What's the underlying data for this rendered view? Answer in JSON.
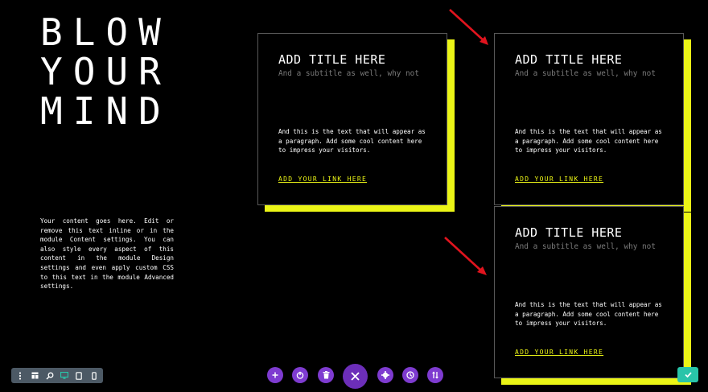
{
  "hero": {
    "lines": [
      "BLOW",
      "YOUR",
      "MIND"
    ]
  },
  "intro": {
    "text": "Your content goes here. Edit or remove this text inline or in the module Content settings. You can also style every aspect of this content in the module Design settings and even apply custom CSS to this text in the module Advanced settings."
  },
  "cards": [
    {
      "title": "ADD TITLE HERE",
      "subtitle": "And a subtitle as well, why not",
      "text": "And this is the text that will appear as a paragraph. Add some cool content here to impress your visitors.",
      "link": "ADD YOUR LINK HERE"
    },
    {
      "title": "ADD TITLE HERE",
      "subtitle": "And a subtitle as well, why not",
      "text": "And this is the text that will appear as a paragraph. Add some cool content here to impress your visitors.",
      "link": "ADD YOUR LINK HERE"
    },
    {
      "title": "ADD TITLE HERE",
      "subtitle": "And a subtitle as well, why not",
      "text": "And this is the text that will appear as a paragraph. Add some cool content here to impress your visitors.",
      "link": "ADD YOUR LINK HERE"
    }
  ],
  "colors": {
    "accent": "#ebf516",
    "builder_purple": "#7e3bd0",
    "save_green": "#29c4a9",
    "annotation_arrow": "#e0141e",
    "card_border": "#585858"
  },
  "toolbar": {
    "left_icons": [
      "more-options-icon",
      "wireframe-icon",
      "zoom-icon",
      "desktop-view-icon",
      "tablet-view-icon",
      "phone-view-icon"
    ],
    "center_icons": [
      "add-icon",
      "portability-icon",
      "clear-layout-icon",
      "close-icon",
      "page-settings-icon",
      "history-icon",
      "sort-icon"
    ],
    "save_icon": "checkmark-icon"
  }
}
